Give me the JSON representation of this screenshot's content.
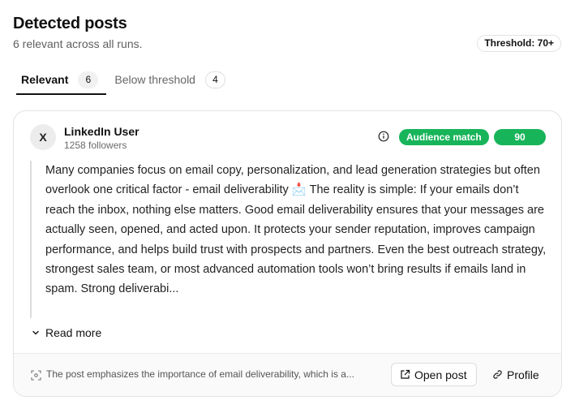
{
  "header": {
    "title": "Detected posts",
    "subtitle": "6 relevant across all runs.",
    "threshold_badge": "Threshold: 70+"
  },
  "tabs": [
    {
      "label": "Relevant",
      "count": "6",
      "active": true
    },
    {
      "label": "Below threshold",
      "count": "4",
      "active": false
    }
  ],
  "post": {
    "avatar_initial": "X",
    "author_name": "LinkedIn User",
    "followers": "1258 followers",
    "match_label": "Audience match",
    "score": "90",
    "text": "Many companies focus on email copy, personalization, and lead generation strategies but often overlook one critical factor - email deliverability 📩 The reality is simple: If your emails don’t reach the inbox, nothing else matters. Good email deliverability ensures that your messages are actually seen, opened, and acted upon. It protects your sender reputation, improves campaign performance, and helps build trust with prospects and partners. Even the best outreach strategy, strongest sales team, or most advanced automation tools won’t bring results if emails land in spam. Strong deliverabi...",
    "read_more_label": "Read more",
    "summary": "The post emphasizes the importance of email deliverability, which is a...",
    "open_post_label": "Open post",
    "profile_label": "Profile"
  },
  "colors": {
    "accent_green": "#18b45a",
    "text_primary": "#111111",
    "text_muted": "#5f5f5f"
  },
  "icons": {
    "info": "info-icon",
    "chevron": "chevron-down-icon",
    "summary": "ai-scan-icon",
    "external": "external-link-icon",
    "link": "link-icon"
  }
}
